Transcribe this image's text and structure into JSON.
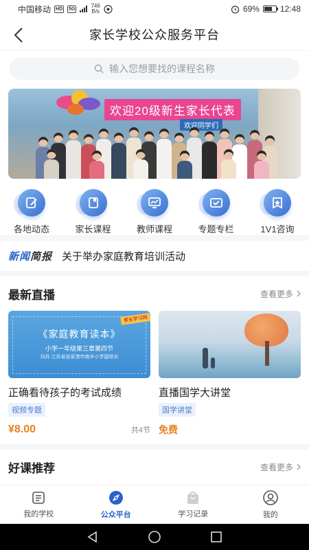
{
  "status_bar": {
    "carrier": "中国移动",
    "hd": "HD",
    "net": "5G",
    "speed_value": "746",
    "speed_unit": "B/s",
    "battery": "69%",
    "time": "12:48"
  },
  "header": {
    "title": "家长学校公众服务平台"
  },
  "search": {
    "placeholder": "输入您想要找的课程名称"
  },
  "banner": {
    "caption": "欢迎20级新生家长代表",
    "sign": "欢迎同学们"
  },
  "categories": [
    {
      "label": "各地动态",
      "icon": "edit-icon"
    },
    {
      "label": "家长课程",
      "icon": "book-icon"
    },
    {
      "label": "教师课程",
      "icon": "chart-icon"
    },
    {
      "label": "专题专栏",
      "icon": "folder-check-icon"
    },
    {
      "label": "1V1咨询",
      "icon": "star-badge-icon"
    }
  ],
  "news": {
    "tag_a": "新闻",
    "tag_b": "简报",
    "text": "关于举办家庭教育培训活动"
  },
  "live": {
    "title": "最新直播",
    "more": "查看更多",
    "cards": [
      {
        "thumb_title": "《家庭教育读本》",
        "thumb_sub": "小学一年级第三章第四节",
        "thumb_sub2": "刘兵 江苏省张家港市南丰小学副校长",
        "thumb_corner": "家长学习网",
        "title": "正确看待孩子的考试成绩",
        "tag": "视频专题",
        "price": "¥8.00",
        "count": "共4节"
      },
      {
        "title": "直播国学大讲堂",
        "tag": "国学讲堂",
        "price": "免费"
      }
    ]
  },
  "recommend": {
    "title": "好课推荐",
    "more": "查看更多"
  },
  "tabs": [
    {
      "label": "我的学校",
      "icon": "school-icon",
      "active": false
    },
    {
      "label": "公众平台",
      "icon": "compass-icon",
      "active": true
    },
    {
      "label": "学习记录",
      "icon": "bag-icon",
      "active": false
    },
    {
      "label": "我的",
      "icon": "user-icon",
      "active": false
    }
  ],
  "colors": {
    "accent": "#2a62c9",
    "price": "#e9801e",
    "banner_caption": "#e94590"
  }
}
